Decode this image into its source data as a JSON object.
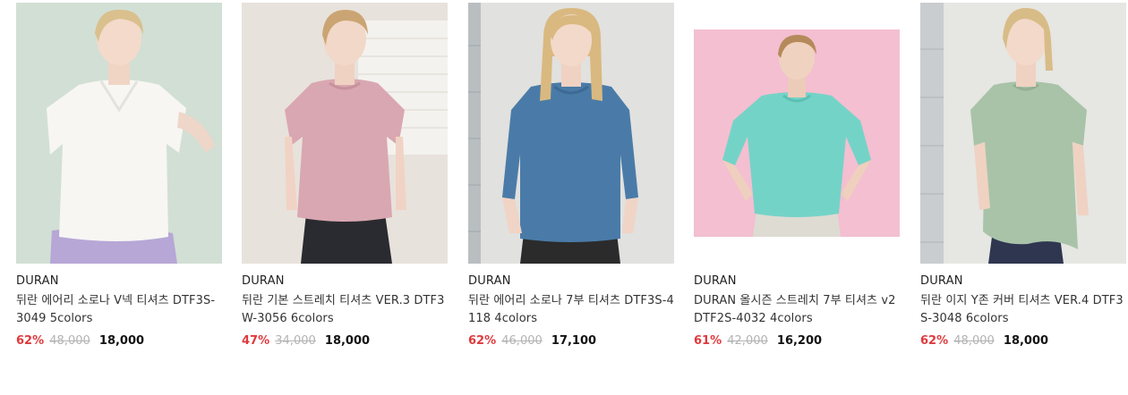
{
  "colors": {
    "discount": "#e03a3e",
    "original_price": "#b3b3b3",
    "sale_price": "#111111"
  },
  "products": [
    {
      "brand": "DURAN",
      "name": "뒤란 에어리 소로나 V넥 티셔츠 DTF3S-3049 5colors",
      "discount": "62%",
      "original_price": "48,000",
      "sale_price": "18,000",
      "image": "white-vneck-tshirt-photo"
    },
    {
      "brand": "DURAN",
      "name": "뒤란 기본 스트레치 티셔츠 VER.3 DTF3W-3056 6colors",
      "discount": "47%",
      "original_price": "34,000",
      "sale_price": "18,000",
      "image": "pink-tshirt-photo"
    },
    {
      "brand": "DURAN",
      "name": "뒤란 에어리 소로나 7부 티셔츠 DTF3S-4118 4colors",
      "discount": "62%",
      "original_price": "46,000",
      "sale_price": "17,100",
      "image": "blue-three-quarter-tshirt-photo"
    },
    {
      "brand": "DURAN",
      "name": "DURAN 올시즌 스트레치 7부 티셔츠 v2 DTF2S-4032 4colors",
      "discount": "61%",
      "original_price": "42,000",
      "sale_price": "16,200",
      "image": "mint-three-quarter-tshirt-photo"
    },
    {
      "brand": "DURAN",
      "name": "뒤란 이지 Y존 커버 티셔츠 VER.4 DTF3S-3048 6colors",
      "discount": "62%",
      "original_price": "48,000",
      "sale_price": "18,000",
      "image": "sage-long-tshirt-photo"
    }
  ]
}
